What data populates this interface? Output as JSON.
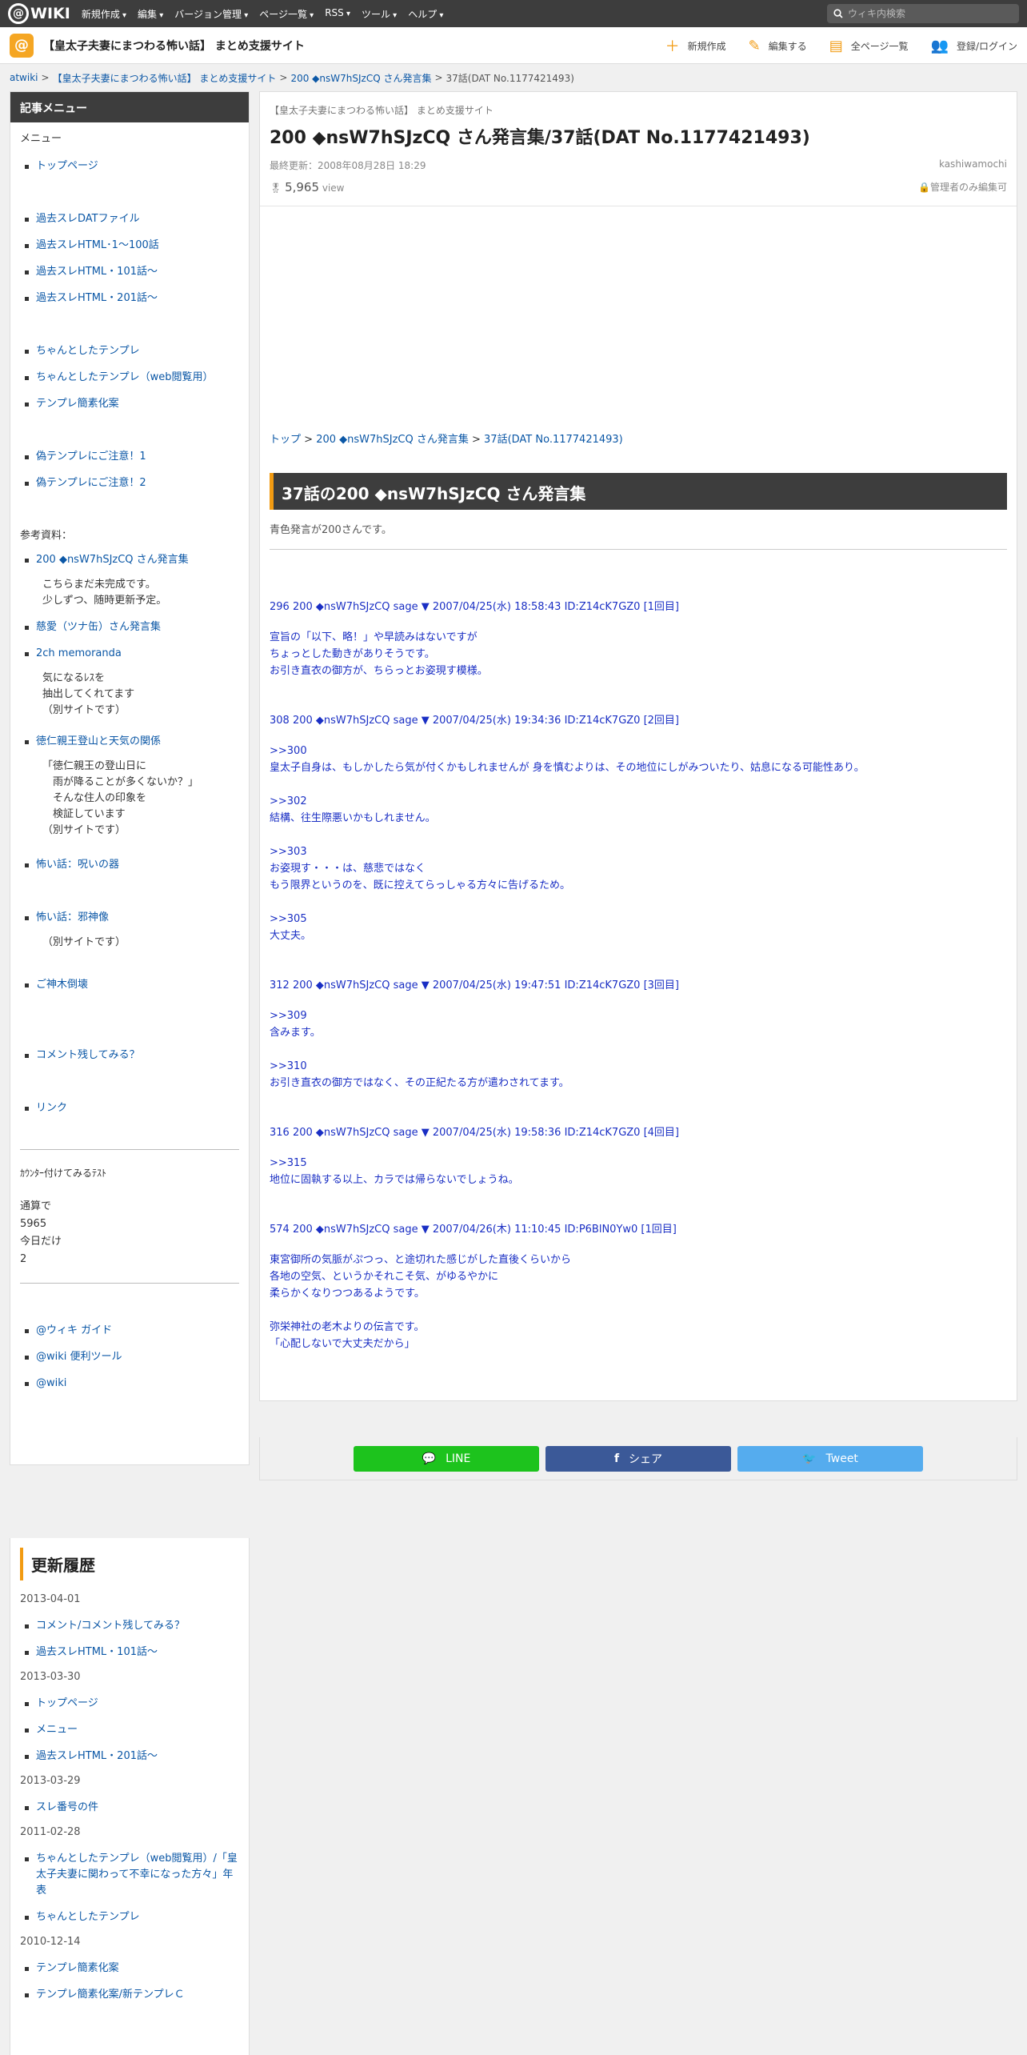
{
  "topbar": {
    "logo": "WIKI",
    "nav": [
      "新規作成",
      "編集",
      "バージョン管理",
      "ページ一覧",
      "RSS",
      "ツール",
      "ヘルプ"
    ],
    "search_placeholder": "ウィキ内検索"
  },
  "site": {
    "title": "【皇太子夫妻にまつわる怖い話】 まとめ支援サイト",
    "actions": [
      "新規作成",
      "編集する",
      "全ページ一覧",
      "登録/ログイン"
    ]
  },
  "breadcrumb": [
    "atwiki",
    "【皇太子夫妻にまつわる怖い話】 まとめ支援サイト",
    "200 ◆nsW7hSJzCQ さん発言集",
    "37話(DAT No.1177421493)"
  ],
  "sidebar": {
    "header": "記事メニュー",
    "menu_label": "メニュー",
    "groups": [
      {
        "items": [
          "トップページ"
        ]
      },
      {
        "items": [
          "過去スレDATファイル",
          "過去スレHTML･1～100話",
          "過去スレHTML・101話～",
          "過去スレHTML・201話～"
        ]
      },
      {
        "items": [
          "ちゃんとしたテンプレ",
          "ちゃんとしたテンプレ（web閲覧用）",
          "テンプレ簡素化案"
        ]
      },
      {
        "items": [
          "偽テンプレにご注意！1",
          "偽テンプレにご注意！2"
        ]
      }
    ],
    "ref_label": "参考資料：",
    "refs": [
      {
        "label": "200 ◆nsW7hSJzCQ さん発言集",
        "notes": [
          "こちらまだ未完成です。",
          "少しずつ、随時更新予定。"
        ]
      },
      {
        "label": "慈愛（ツナ缶）さん発言集",
        "notes": []
      },
      {
        "label": "2ch memoranda",
        "notes": [
          "気になるﾚｽを",
          "抽出してくれてます",
          "（別サイトです）"
        ]
      },
      {
        "label": "徳仁親王登山と天気の関係",
        "notes": [
          "「徳仁親王の登山日に",
          "　雨が降ることが多くないか？」",
          "　そんな住人の印象を",
          "　検証しています",
          "（別サイトです）"
        ]
      },
      {
        "label": "怖い話：呪いの器",
        "notes": []
      },
      {
        "label": "怖い話：邪神像",
        "notes": [
          "（別サイトです）"
        ]
      },
      {
        "label": "ご神木倒壊",
        "notes": []
      },
      {
        "label": "コメント残してみる？",
        "notes": []
      },
      {
        "label": "リンク",
        "notes": []
      }
    ],
    "counter_title": "ｶｳﾝﾀｰ付けてみるﾃｽﾄ",
    "counter_total_label": "通算で",
    "counter_total": "5965",
    "counter_today_label": "今日だけ",
    "counter_today": "2",
    "tools": [
      "@ウィキ ガイド",
      "@wiki 便利ツール",
      "@wiki"
    ]
  },
  "main": {
    "site_sub": "【皇太子夫妻にまつわる怖い話】 まとめ支援サイト",
    "title": "200 ◆nsW7hSJzCQ さん発言集/37話(DAT No.1177421493)",
    "updated": "最終更新：2008年08月28日 18:29",
    "author": "kashiwamochi",
    "views": "5,965",
    "views_unit": "view",
    "permission": "管理者のみ編集可",
    "topic_crumb": [
      "トップ",
      "200 ◆nsW7hSJzCQ さん発言集",
      "37話(DAT No.1177421493)"
    ],
    "section_title": "37話の200 ◆nsW7hSJzCQ さん発言集",
    "intro": "青色発言が200さんです。",
    "posts": [
      {
        "head": "296 200 ◆nsW7hSJzCQ sage ▼ 2007/04/25(水) 18:58:43 ID:Z14cK7GZ0 [1回目]",
        "lines": [
          "宣旨の「以下、略！」や早読みはないですが",
          "ちょっとした動きがありそうです。",
          "お引き直衣の御方が、ちらっとお姿現す模様。"
        ]
      },
      {
        "head": "308 200 ◆nsW7hSJzCQ sage ▼ 2007/04/25(水) 19:34:36 ID:Z14cK7GZ0 [2回目]",
        "lines": [
          ">>300",
          "皇太子自身は、もしかしたら気が付くかもしれませんが 身を慎むよりは、その地位にしがみついたり、姑息になる可能性あり。",
          "",
          ">>302",
          "結構、往生際悪いかもしれません。",
          "",
          ">>303",
          "お姿現す・・・は、慈悲ではなく",
          "もう限界というのを、既に控えてらっしゃる方々に告げるため。",
          "",
          ">>305",
          "大丈夫。"
        ]
      },
      {
        "head": "312 200 ◆nsW7hSJzCQ sage ▼ 2007/04/25(水) 19:47:51 ID:Z14cK7GZ0 [3回目]",
        "lines": [
          ">>309",
          "含みます。",
          "",
          ">>310",
          "お引き直衣の御方ではなく、その正紀たる方が遣わされてます。"
        ]
      },
      {
        "head": "316 200 ◆nsW7hSJzCQ sage ▼ 2007/04/25(水) 19:58:36 ID:Z14cK7GZ0 [4回目]",
        "lines": [
          ">>315",
          "地位に固執する以上、カラでは帰らないでしょうね。"
        ]
      },
      {
        "head": "574 200 ◆nsW7hSJzCQ sage ▼ 2007/04/26(木) 11:10:45 ID:P6BlN0Yw0 [1回目]",
        "lines": [
          "東宮御所の気脈がぷつっ、と途切れた感じがした直後くらいから",
          "各地の空気、というかそれこそ気、がゆるやかに",
          "柔らかくなりつつあるようです。",
          "",
          "弥栄神社の老木よりの伝言です。",
          "「心配しないで大丈夫だから」"
        ]
      }
    ]
  },
  "share": {
    "line": "LINE",
    "facebook": "シェア",
    "twitter": "Tweet"
  },
  "history": {
    "title": "更新履歴",
    "entries": [
      {
        "date": "2013-04-01",
        "items": [
          "コメント/コメント残してみる？",
          "過去スレHTML・101話～"
        ]
      },
      {
        "date": "2013-03-30",
        "items": [
          "トップページ",
          "メニュー",
          "過去スレHTML・201話～"
        ]
      },
      {
        "date": "2013-03-29",
        "items": [
          "スレ番号の件"
        ]
      },
      {
        "date": "2011-02-28",
        "items": [
          "ちゃんとしたテンプレ（web閲覧用）/「皇太子夫妻に関わって不幸になった方々」年表",
          "ちゃんとしたテンプレ"
        ]
      },
      {
        "date": "2010-12-14",
        "items": [
          "テンプレ簡素化案",
          "テンプレ簡素化案/新テンプレＣ"
        ]
      }
    ]
  },
  "colors": {
    "header_bg": "#3d3d3d",
    "accent": "#f29b12",
    "link": "#0b57a6",
    "post_text": "#1a2fc4"
  }
}
